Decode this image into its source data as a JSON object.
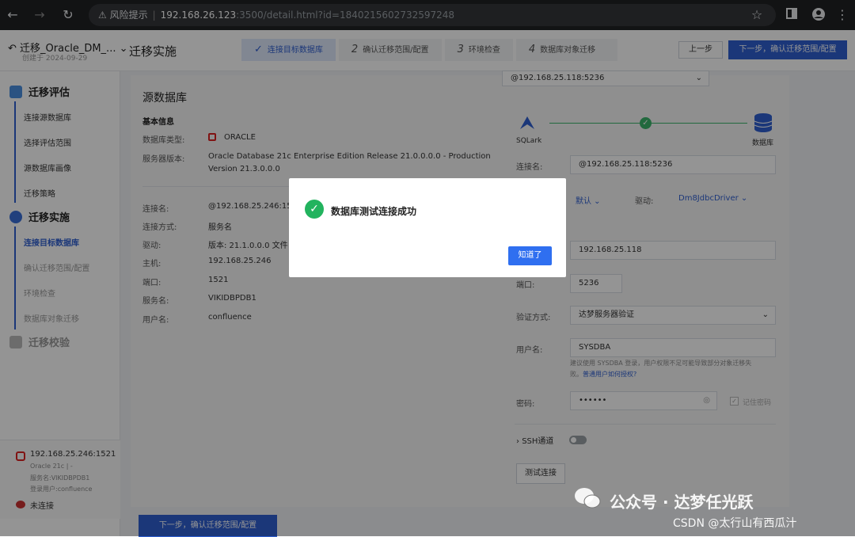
{
  "browser": {
    "warning": "风险提示",
    "url_host": "192.168.26.123",
    "url_path": ":3500/detail.html?id=1840215602732597248"
  },
  "header": {
    "project_title": "迁移_Oracle_DM_...",
    "project_date": "创建于 2024-09-29",
    "page_title": "迁移实施",
    "steps": [
      {
        "num": "",
        "label": "连接目标数据库"
      },
      {
        "num": "2",
        "label": "确认迁移范围/配置"
      },
      {
        "num": "3",
        "label": "环境检查"
      },
      {
        "num": "4",
        "label": "数据库对象迁移"
      }
    ],
    "prev_label": "上一步",
    "next_label": "下一步，确认迁移范围/配置"
  },
  "sidebar": {
    "sec1": "迁移评估",
    "sec1_items": [
      "连接源数据库",
      "选择评估范围",
      "源数据库画像",
      "迁移策略"
    ],
    "sec2": "迁移实施",
    "sec2_items": [
      "连接目标数据库",
      "确认迁移范围/配置",
      "环境检查",
      "数据库对象迁移"
    ],
    "sec3": "迁移校验",
    "conn_src": "192.168.25.246:1521",
    "conn_src_line1": "Oracle 21c | -",
    "conn_src_line2": "服务名:VIKIDBPDB1",
    "conn_src_line3": "登录用户:confluence",
    "conn_dst": "未连接"
  },
  "source": {
    "title": "源数据库",
    "basic": "基本信息",
    "type_label": "数据库类型:",
    "type_val": "ORACLE",
    "ver_label": "服务器版本:",
    "ver_val1": "Oracle Database 21c Enterprise Edition Release 21.0.0.0.0 - Production",
    "ver_val2": "Version 21.3.0.0.0",
    "rows": [
      {
        "label": "连接名:",
        "value": "@192.168.25.246:1521"
      },
      {
        "label": "连接方式:",
        "value": "服务名"
      },
      {
        "label": "驱动:",
        "value": "版本: 21.1.0.0.0    文件"
      },
      {
        "label": "主机:",
        "value": "192.168.25.246"
      },
      {
        "label": "端口:",
        "value": "1521"
      },
      {
        "label": "服务名:",
        "value": "VIKIDBPDB1"
      },
      {
        "label": "用户名:",
        "value": "confluence"
      }
    ],
    "next_label": "下一步，确认迁移范围/配置"
  },
  "target": {
    "select_value": "@192.168.25.118:5236",
    "sqlark": "SQLark",
    "db_label": "数据库",
    "conn_name_label": "连接名:",
    "conn_name_val": "@192.168.25.118:5236",
    "default_label": "默认",
    "driver_label": "驱动:",
    "driver_val": "Dm8JdbcDriver",
    "host_val": "192.168.25.118",
    "port_label": "端口:",
    "port_val": "5236",
    "auth_label": "验证方式:",
    "auth_val": "达梦服务器验证",
    "user_label": "用户名:",
    "user_val": "SYSDBA",
    "hint1": "建议使用 SYSDBA 登录，用户权限不足可能导致部分对象迁移失",
    "hint2": "败。",
    "hint_link": "普通用户如何授权?",
    "pwd_label": "密码:",
    "pwd_val": "••••••",
    "remember": "记住密码",
    "ssh_label": "SSH通道",
    "test_label": "测试连接"
  },
  "modal": {
    "message": "数据库测试连接成功",
    "ok_label": "知道了"
  },
  "watermark": {
    "line1": "公众号 · 达梦任光跃",
    "line2": "CSDN @太行山有西瓜汁"
  }
}
